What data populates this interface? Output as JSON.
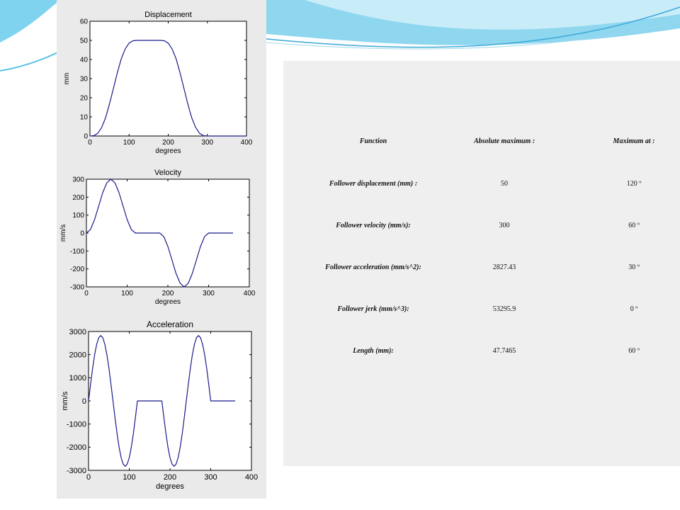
{
  "colors": {
    "series": "#1a1a8c",
    "panel": "#eaeaea",
    "table_bg": "#efefef",
    "slide_accent": "#5bc0e8"
  },
  "chart_data": [
    {
      "type": "line",
      "title": "Displacement",
      "xlabel": "degrees",
      "ylabel": "mm",
      "xlim": [
        0,
        400
      ],
      "ylim": [
        0,
        60
      ],
      "xticks": [
        "0",
        "100",
        "200",
        "300",
        "400"
      ],
      "yticks": [
        "0",
        "10",
        "20",
        "30",
        "40",
        "50",
        "60"
      ],
      "grid": false,
      "x": [
        0,
        10,
        20,
        30,
        40,
        50,
        60,
        70,
        80,
        90,
        100,
        110,
        120,
        130,
        140,
        150,
        160,
        170,
        180,
        190,
        200,
        210,
        220,
        230,
        240,
        250,
        260,
        270,
        280,
        290,
        300,
        310,
        320,
        330,
        340,
        350,
        360,
        400
      ],
      "series": [
        {
          "values": [
            0,
            0.2,
            1.4,
            4.5,
            9.6,
            16.8,
            25,
            33.2,
            40.4,
            45.5,
            48.6,
            49.8,
            50,
            50,
            50,
            50,
            50,
            50,
            50,
            49.8,
            48.6,
            45.5,
            40.4,
            33.2,
            25,
            16.8,
            9.6,
            4.5,
            1.4,
            0.2,
            0,
            0,
            0,
            0,
            0,
            0,
            0,
            0
          ]
        }
      ]
    },
    {
      "type": "line",
      "title": "Velocity",
      "xlabel": "degrees",
      "ylabel": "mm/s",
      "xlim": [
        0,
        400
      ],
      "ylim": [
        -300,
        300
      ],
      "xticks": [
        "0",
        "100",
        "200",
        "300",
        "400"
      ],
      "yticks": [
        "-300",
        "-200",
        "-100",
        "0",
        "100",
        "200",
        "300"
      ],
      "grid": false,
      "x": [
        0,
        10,
        20,
        30,
        40,
        50,
        60,
        70,
        80,
        90,
        100,
        110,
        120,
        180,
        190,
        200,
        210,
        220,
        230,
        240,
        250,
        260,
        270,
        280,
        290,
        300,
        360
      ],
      "series": [
        {
          "values": [
            0,
            20,
            75,
            150,
            225,
            280,
            300,
            280,
            225,
            150,
            75,
            20,
            0,
            0,
            -20,
            -75,
            -150,
            -225,
            -280,
            -300,
            -280,
            -225,
            -150,
            -75,
            -20,
            0,
            0
          ]
        }
      ]
    },
    {
      "type": "line",
      "title": "Acceleration",
      "xlabel": "degrees",
      "ylabel": "mm/s",
      "xlim": [
        0,
        400
      ],
      "ylim": [
        -3000,
        3000
      ],
      "xticks": [
        "0",
        "100",
        "200",
        "300",
        "400"
      ],
      "yticks": [
        "-3000",
        "-2000",
        "-1000",
        "0",
        "1000",
        "2000",
        "3000"
      ],
      "grid": false,
      "x": [
        0,
        5,
        10,
        15,
        20,
        25,
        30,
        35,
        40,
        45,
        50,
        55,
        60,
        65,
        70,
        75,
        80,
        85,
        90,
        95,
        100,
        105,
        110,
        115,
        120,
        180,
        185,
        190,
        195,
        200,
        205,
        210,
        215,
        220,
        225,
        230,
        235,
        240,
        245,
        250,
        255,
        260,
        265,
        270,
        275,
        280,
        285,
        290,
        295,
        300,
        360
      ],
      "series": [
        {
          "values": [
            0,
            732,
            1414,
            2000,
            2449,
            2732,
            2827,
            2732,
            2449,
            2000,
            1414,
            732,
            0,
            -732,
            -1414,
            -2000,
            -2449,
            -2732,
            -2827,
            -2732,
            -2449,
            -2000,
            -1414,
            -732,
            0,
            0,
            -732,
            -1414,
            -2000,
            -2449,
            -2732,
            -2827,
            -2732,
            -2449,
            -2000,
            -1414,
            -732,
            0,
            732,
            1414,
            2000,
            2449,
            2732,
            2827,
            2732,
            2449,
            2000,
            1414,
            732,
            0,
            0
          ]
        }
      ]
    }
  ],
  "table": {
    "headers": [
      "Function",
      "Absolute maximum :",
      "Maximum at :"
    ],
    "rows": [
      {
        "label": "Follower displacement (mm) :",
        "value": "50",
        "at": "120 º"
      },
      {
        "label": "Follower velocity (mm/s):",
        "value": "300",
        "at": "60 º"
      },
      {
        "label": "Follower acceleration (mm/s^2):",
        "value": "2827.43",
        "at": "30 º"
      },
      {
        "label": "Follower jerk (mm/s^3):",
        "value": "53295.9",
        "at": "0 º"
      },
      {
        "label": "Length (mm):",
        "value": "47.7465",
        "at": "60 º"
      }
    ]
  }
}
